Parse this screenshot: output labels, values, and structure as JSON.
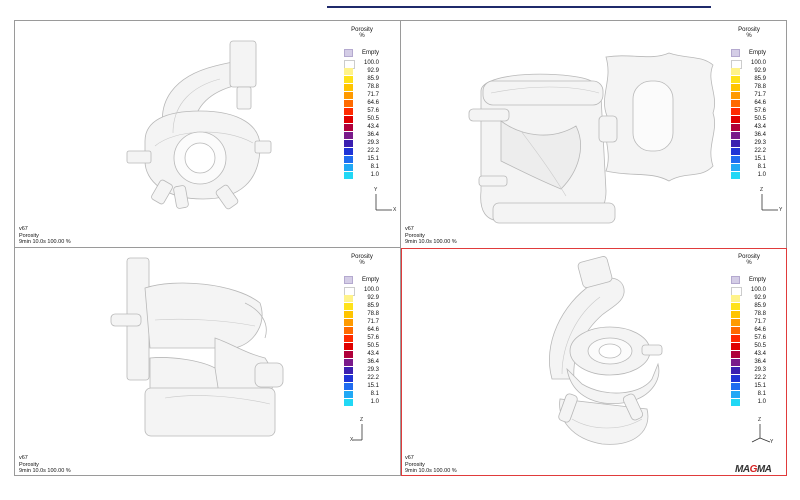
{
  "legend": {
    "title_line1": "Porosity",
    "title_line2": "%",
    "empty_label": "Empty",
    "entries": [
      {
        "label": "100.0",
        "color": "#ffffff"
      },
      {
        "label": "92.9",
        "color": "#fff38a"
      },
      {
        "label": "85.9",
        "color": "#ffe21a"
      },
      {
        "label": "78.8",
        "color": "#ffc400"
      },
      {
        "label": "71.7",
        "color": "#ff9a00"
      },
      {
        "label": "64.6",
        "color": "#ff6a00"
      },
      {
        "label": "57.6",
        "color": "#ff2a00"
      },
      {
        "label": "50.5",
        "color": "#e00000"
      },
      {
        "label": "43.4",
        "color": "#b0003a"
      },
      {
        "label": "36.4",
        "color": "#7a1a8a"
      },
      {
        "label": "29.3",
        "color": "#3b1fb0"
      },
      {
        "label": "22.2",
        "color": "#1f34d6"
      },
      {
        "label": "15.1",
        "color": "#1f6cf0"
      },
      {
        "label": "8.1",
        "color": "#20a8f5"
      },
      {
        "label": "1.0",
        "color": "#21d8f5"
      }
    ]
  },
  "viewports": [
    {
      "name": "top-left",
      "info_line1": "v67",
      "info_line2": "Porosity",
      "info_line3": "9min 10.0s 100.00 %",
      "axis_a": "Y",
      "axis_b": "X"
    },
    {
      "name": "top-right",
      "info_line1": "v67",
      "info_line2": "Porosity",
      "info_line3": "9min 10.0s 100.00 %",
      "axis_a": "Z",
      "axis_b": "Y"
    },
    {
      "name": "bottom-left",
      "info_line1": "v67",
      "info_line2": "Porosity",
      "info_line3": "9min 10.0s 100.00 %",
      "axis_a": "Z",
      "axis_b": "X"
    },
    {
      "name": "bottom-right",
      "info_line1": "v67",
      "info_line2": "Porosity",
      "info_line3": "9min 10.0s 100.00 %",
      "axis_a": "Z",
      "axis_b": "Y"
    }
  ],
  "logo": {
    "text": "MAGMA"
  },
  "colors": {
    "active_viewport_border": "#e03b3b",
    "part_fill": "#f2f2f2",
    "part_edge": "#b8b8b8",
    "topbar": "#1f2a6b"
  }
}
